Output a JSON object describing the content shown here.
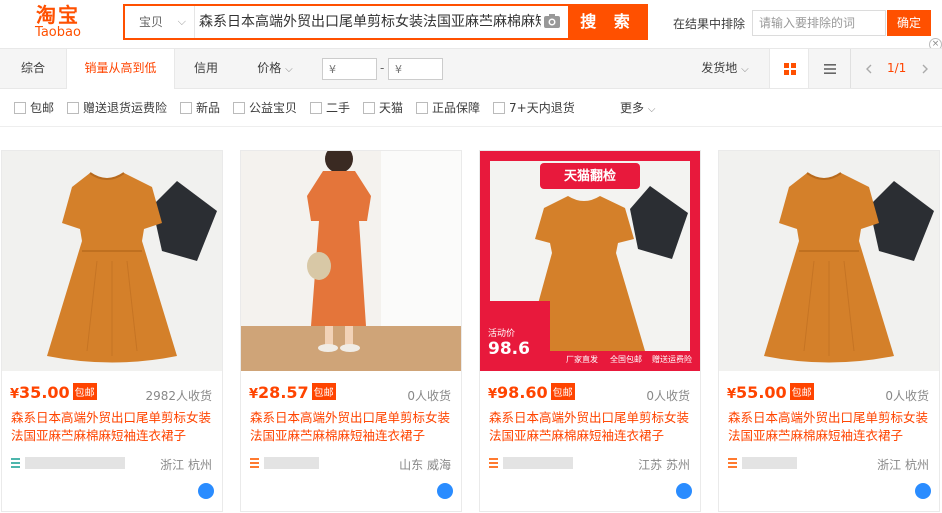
{
  "header": {
    "logo_cn": "淘宝",
    "logo_en": "Taobao",
    "scope": "宝贝",
    "query": "森系日本高端外贸出口尾单剪标女装法国亚麻苎麻棉麻短袖连衣裙子",
    "search_label": "搜 索",
    "exclude_label": "在结果中排除",
    "exclude_placeholder": "请输入要排除的词",
    "confirm_label": "确定",
    "close_glyph": "×"
  },
  "sortbar": {
    "items": [
      "综合",
      "销量从高到低",
      "信用",
      "价格"
    ],
    "currency": "¥",
    "dash": "-",
    "ship_from": "发货地",
    "page": "1/1",
    "chev_down": "⌵"
  },
  "filters": {
    "options": [
      "包邮",
      "赠送退货运费险",
      "新品",
      "公益宝贝",
      "二手",
      "天猫",
      "正品保障",
      "7+天内退货"
    ],
    "more": "更多"
  },
  "colors": {
    "accent": "#ff5000",
    "price": "#ff4400"
  },
  "products": [
    {
      "price": "35.00",
      "badge": "包邮",
      "sold": "2982人收货",
      "title": "森系日本高端外贸出口尾单剪标女装法国亚麻苎麻棉麻短袖连衣裙子",
      "location": "浙江 杭州"
    },
    {
      "price": "28.57",
      "badge": "包邮",
      "sold": "0人收货",
      "title": "森系日本高端外贸出口尾单剪标女装法国亚麻苎麻棉麻短袖连衣裙子",
      "location": "山东 威海"
    },
    {
      "price": "98.60",
      "badge": "包邮",
      "sold": "0人收货",
      "title": "森系日本高端外贸出口尾单剪标女装法国亚麻苎麻棉麻短袖连衣裙子",
      "location": "江苏 苏州",
      "promo": {
        "banner": "天猫翻检",
        "price_label": "活动价",
        "price": "98.6",
        "footer": [
          "厂家直发",
          "全国包邮",
          "赠送运费险"
        ]
      }
    },
    {
      "price": "55.00",
      "badge": "包邮",
      "sold": "0人收货",
      "title": "森系日本高端外贸出口尾单剪标女装法国亚麻苎麻棉麻短袖连衣裙子",
      "location": "浙江 杭州"
    }
  ],
  "currency_symbol": "¥"
}
